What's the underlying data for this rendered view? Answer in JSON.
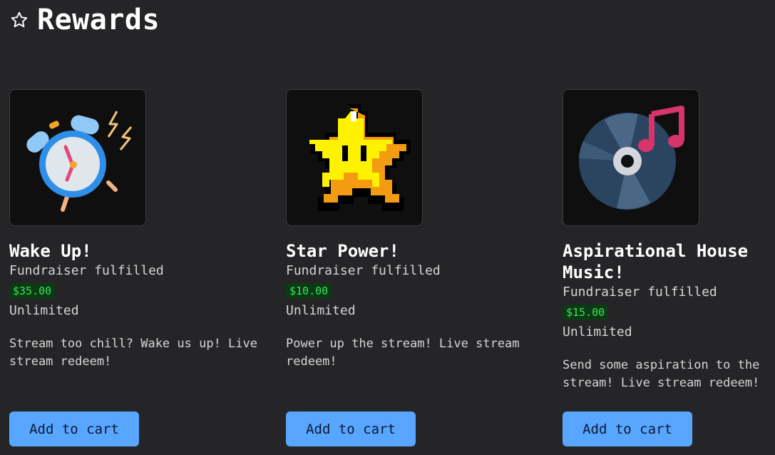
{
  "page": {
    "title": "Rewards"
  },
  "rewards": [
    {
      "title": "Wake Up!",
      "status": "Fundraiser fulfilled",
      "price": "$35.00",
      "quantity": "Unlimited",
      "description": "Stream too chill? Wake us up! Live stream redeem!",
      "button": "Add to cart",
      "image_icon": "alarm-clock-icon"
    },
    {
      "title": "Star Power!",
      "status": "Fundraiser fulfilled",
      "price": "$10.00",
      "quantity": "Unlimited",
      "description": "Power up the stream! Live stream redeem!",
      "button": "Add to cart",
      "image_icon": "pixel-star-icon"
    },
    {
      "title": "Aspirational House Music!",
      "status": "Fundraiser fulfilled",
      "price": "$15.00",
      "quantity": "Unlimited",
      "description": "Send some aspiration to the stream! Live stream redeem!",
      "button": "Add to cart",
      "image_icon": "vinyl-music-icon"
    }
  ],
  "colors": {
    "background": "#252427",
    "button": "#58a6ff",
    "price_bg": "#0b3a14",
    "price_text": "#3ee05a"
  }
}
